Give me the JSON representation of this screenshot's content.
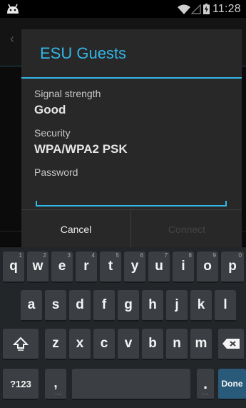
{
  "status_bar": {
    "time": "11:28",
    "icons": [
      "android-icon",
      "wifi-icon",
      "signal-icon",
      "battery-icon"
    ]
  },
  "dialog": {
    "title": "ESU Guests",
    "fields": [
      {
        "label": "Signal strength",
        "value": "Good"
      },
      {
        "label": "Security",
        "value": "WPA/WPA2 PSK"
      }
    ],
    "password_label": "Password",
    "password_value": "",
    "cancel_label": "Cancel",
    "connect_label": "Connect",
    "accent_color": "#33b5e5"
  },
  "keyboard": {
    "row1": [
      {
        "label": "q",
        "hint": "1"
      },
      {
        "label": "w",
        "hint": "2"
      },
      {
        "label": "e",
        "hint": "3"
      },
      {
        "label": "r",
        "hint": "4"
      },
      {
        "label": "t",
        "hint": "5"
      },
      {
        "label": "y",
        "hint": "6"
      },
      {
        "label": "u",
        "hint": "7"
      },
      {
        "label": "i",
        "hint": "8"
      },
      {
        "label": "o",
        "hint": "9"
      },
      {
        "label": "p",
        "hint": "0"
      }
    ],
    "row2": [
      "a",
      "s",
      "d",
      "f",
      "g",
      "h",
      "j",
      "k",
      "l"
    ],
    "row3": [
      "z",
      "x",
      "c",
      "v",
      "b",
      "n",
      "m"
    ],
    "shift_icon": "shift-icon",
    "backspace_icon": "backspace-icon",
    "symbols_label": "?123",
    "comma_label": ",",
    "period_label": ".",
    "done_label": "Done"
  }
}
